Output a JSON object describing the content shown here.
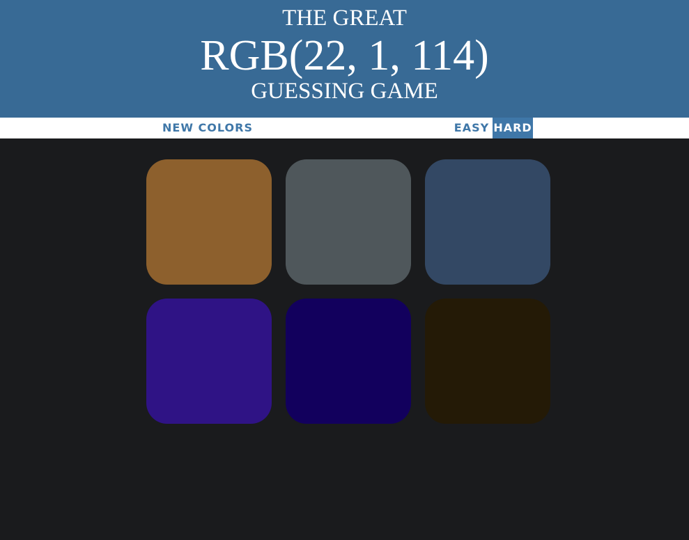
{
  "header": {
    "line1": "THE GREAT",
    "target_color": "RGB(22, 1, 114)",
    "line3": "GUESSING GAME",
    "background": "#386a95"
  },
  "controls": {
    "new_colors_label": "NEW COLORS",
    "easy_label": "EASY",
    "hard_label": "HARD",
    "selected_mode": "HARD",
    "accent_color": "#3f77a8"
  },
  "squares": [
    {
      "color": "#8d602d"
    },
    {
      "color": "#4f575b"
    },
    {
      "color": "#334864"
    },
    {
      "color": "#2f1385"
    },
    {
      "color": "#12005d"
    },
    {
      "color": "#241a06"
    }
  ],
  "background_color": "#1a1b1d"
}
